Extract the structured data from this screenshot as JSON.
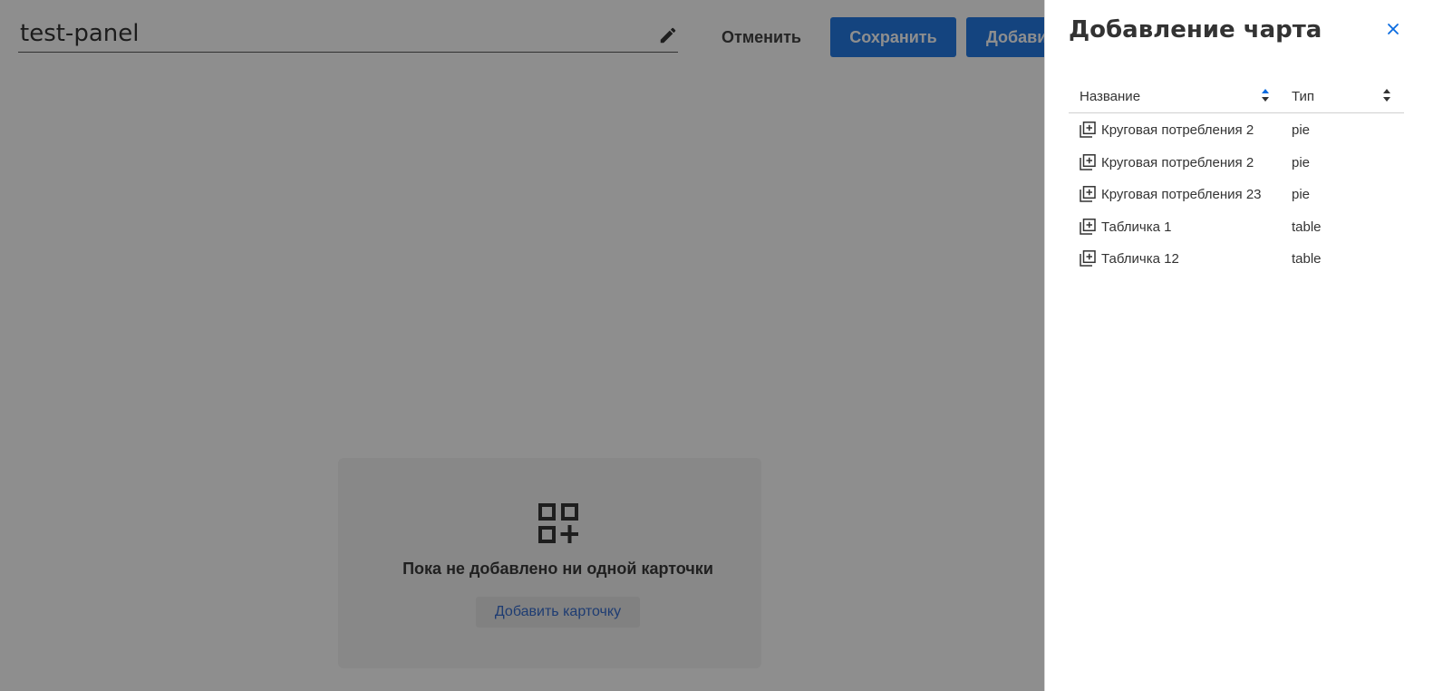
{
  "header": {
    "title": "test-panel",
    "cancel_label": "Отменить",
    "save_label": "Сохранить",
    "add_label": "Добави"
  },
  "empty_state": {
    "message": "Пока не добавлено ни одной карточки",
    "add_card_label": "Добавить карточку"
  },
  "drawer": {
    "title": "Добавление чарта",
    "columns": {
      "name": "Название",
      "type": "Тип"
    },
    "rows": [
      {
        "name": "Круговая потребления 2",
        "type": "pie"
      },
      {
        "name": "Круговая потребления 2",
        "type": "pie"
      },
      {
        "name": "Круговая потребления 23",
        "type": "pie"
      },
      {
        "name": "Табличка 1",
        "type": "table"
      },
      {
        "name": "Табличка 12",
        "type": "table"
      }
    ]
  },
  "colors": {
    "primary": "#0a6be0",
    "link": "#1e5bc6",
    "overlay": "#1e1e1e",
    "sort_active": "#0a6be0"
  },
  "icons": {
    "edit": "pencil-icon",
    "empty": "grid-add-icon",
    "close": "close-icon",
    "sort": "sort-icon",
    "row_add": "library-add-icon"
  }
}
